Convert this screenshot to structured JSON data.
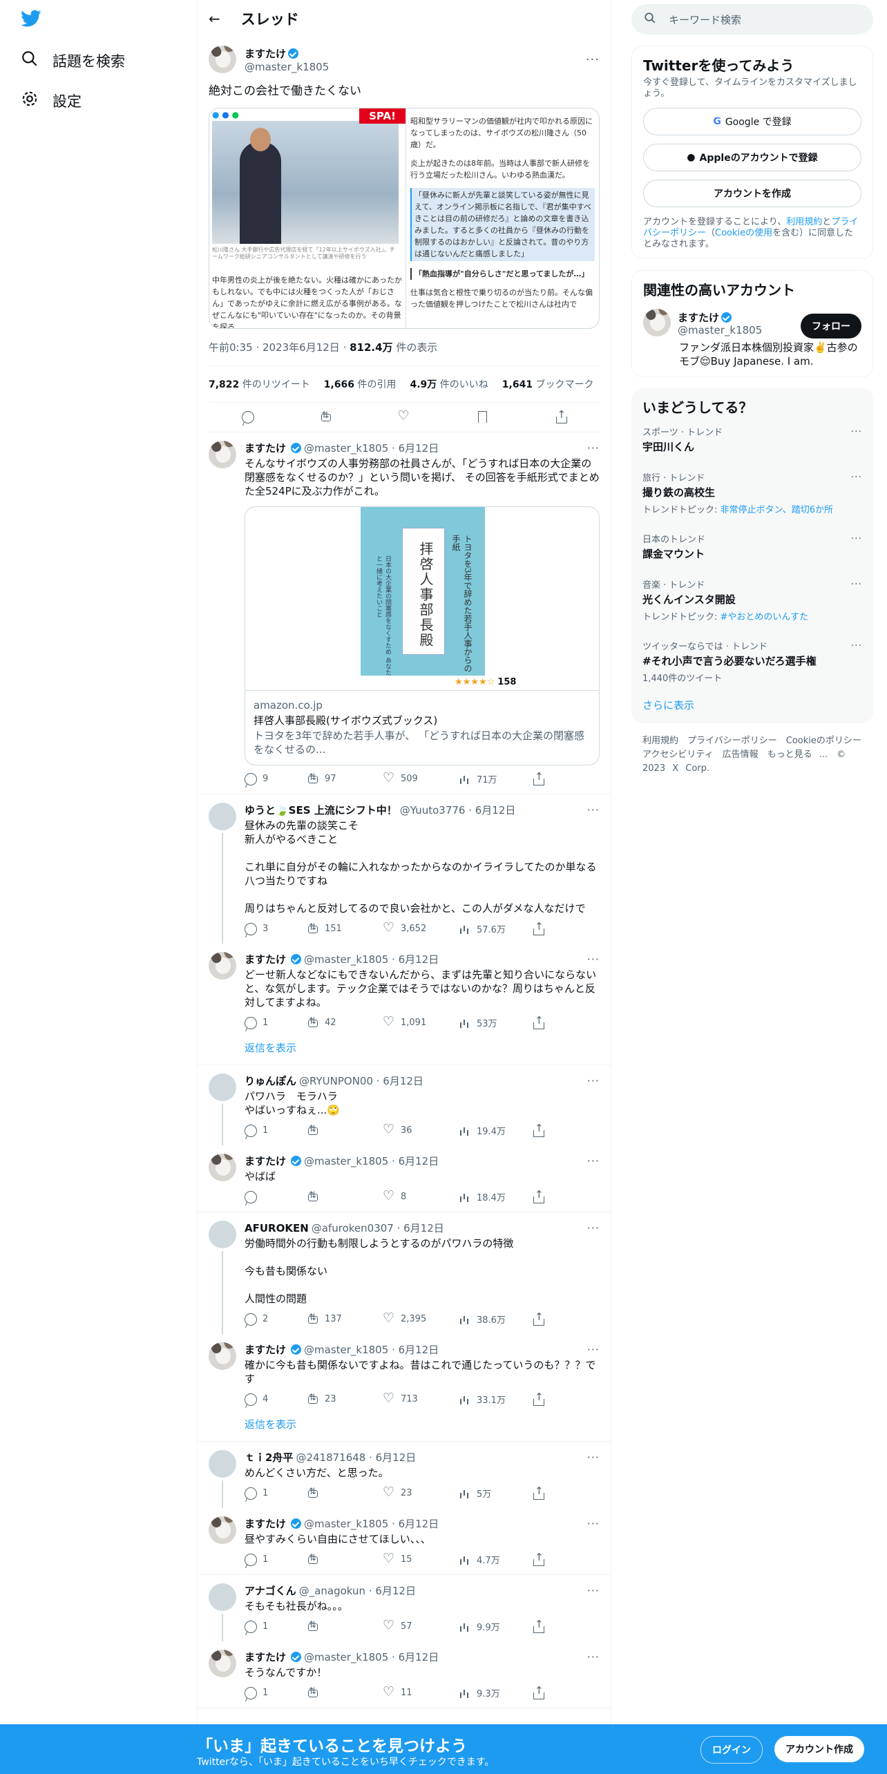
{
  "nav": {
    "items": [
      {
        "label": "話題を検索",
        "icon": "search-icon"
      },
      {
        "label": "設定",
        "icon": "gear-icon"
      }
    ]
  },
  "header": {
    "title": "スレッド"
  },
  "focal": {
    "name": "ますたけ",
    "handle": "@master_k1805",
    "text": "絶対この会社で働きたくない",
    "article": {
      "badge": "SPA!",
      "caption": "松川隆さん 大手銀行や広告代理店を経て「12年以上サイボウズ入社」。チームワーク総研シニアコンサルタントとして講演や研修を行う",
      "left_body": "中年男性の炎上が後を絶たない。火種は確かにあったかもしれない。でも中には火種をつくった人が「おじさん」であったがゆえに余計に燃え広がる事例がある。なぜこんなにも\"叩いていい存在\"になったのか。その背景を探る",
      "p1": "昭和型サラリーマンの価値観が社内で叩かれる原因になってしまったのは、サイボウズの松川隆さん（50歳）だ。",
      "p2": "炎上が起きたのは8年前。当時は人事部で新人研修を行う立場だった松川さん。いわゆる熱血漢だ。",
      "p3": "「昼休みに新人が先輩と談笑している姿が無性に見えて、オンライン掲示板に名指しで、『君が集中すべきことは目の前の研修だろ』と論めの文章を書き込みました。すると多くの社員から『昼休みの行動を制限するのはおかしい』と反論されて。昔のやり方は通じないんだと痛感しました」",
      "p4": "「熱血指導が\"自分らしさ\"だと思ってましたが…」",
      "p5": "仕事は気合と根性で乗り切るのが当たり前。そんな偏った価値観を押しつけたことで松川さんは社内で"
    },
    "time": "午前0:35 · 2023年6月12日 · ",
    "views": "812.4万",
    "views_label": " 件の表示",
    "stats": [
      {
        "n": "7,822",
        "l": " 件のリツイート"
      },
      {
        "n": "1,666",
        "l": " 件の引用"
      },
      {
        "n": "4.9万",
        "l": " 件のいいね"
      },
      {
        "n": "1,641",
        "l": " ブックマーク"
      }
    ]
  },
  "tweets": [
    {
      "name": "ますたけ",
      "verified": true,
      "handle": "@master_k1805 · 6月12日",
      "avatar": "cat",
      "text": "そんなサイボウズの人事労務部の社員さんが、「どうすれば日本の大企業の閉塞感をなくせるのか？」という問いを掲げ、 その回答を手紙形式でまとめた全524Pに及ぶ力作がこれ。",
      "card": {
        "book_title": "拝啓人事部長殿",
        "book_sub": "トヨタを3年で辞めた若手人事からの手紙",
        "book_side": "日本の大企業の閉塞感をなくすため あなたと一緒に考えたいこと",
        "rating": "158",
        "domain": "amazon.co.jp",
        "title": "拝啓人事部長殿(サイボウズ式ブックス)",
        "desc": "トヨタを3年で辞めた若手人事が、 「どうすれば日本の大企業の閉塞感をなくせるの..."
      },
      "reply": "9",
      "rt": "97",
      "like": "509",
      "views": "71万"
    },
    {
      "name": "ゆうと🍃SES 上流にシフト中！",
      "verified": false,
      "handle": "@Yuuto3776 · 6月12日",
      "avatar": "grey",
      "text": "昼休みの先輩の談笑こそ\n新人がやるべきこと\n\nこれ単に自分がその輪に入れなかったからなのかイライラしてたのか単なる八つ当たりですね\n\n周りはちゃんと反対してるので良い会社かと、この人がダメな人なだけで",
      "reply": "3",
      "rt": "151",
      "like": "3,652",
      "views": "57.6万"
    },
    {
      "name": "ますたけ",
      "verified": true,
      "handle": "@master_k1805 · 6月12日",
      "avatar": "cat",
      "text": "どーせ新人などなにもできないんだから、まずは先輩と知り合いにならないと、な気がします。テック企業ではそうではないのかな？周りはちゃんと反対してますよね。",
      "reply": "1",
      "rt": "42",
      "like": "1,091",
      "views": "53万",
      "showmore": "返信を表示"
    },
    {
      "name": "りゅんぽん",
      "verified": false,
      "handle": "@RYUNPON00 · 6月12日",
      "avatar": "grey",
      "text": "パワハラ　モラハラ\nやばいっすねぇ...🙄",
      "reply": "1",
      "rt": "",
      "like": "36",
      "views": "19.4万"
    },
    {
      "name": "ますたけ",
      "verified": true,
      "handle": "@master_k1805 · 6月12日",
      "avatar": "cat",
      "text": "やばば",
      "reply": "",
      "rt": "",
      "like": "8",
      "views": "18.4万"
    },
    {
      "name": "AFUROKEN",
      "verified": false,
      "handle": "@afuroken0307 · 6月12日",
      "avatar": "grey",
      "text": "労働時間外の行動も制限しようとするのがパワハラの特徴\n\n今も昔も関係ない\n\n人間性の問題",
      "reply": "2",
      "rt": "137",
      "like": "2,395",
      "views": "38.6万"
    },
    {
      "name": "ますたけ",
      "verified": true,
      "handle": "@master_k1805 · 6月12日",
      "avatar": "cat",
      "text": "確かに今も昔も関係ないですよね。昔はこれで通じたっていうのも？？？です",
      "reply": "4",
      "rt": "23",
      "like": "713",
      "views": "33.1万",
      "showmore": "返信を表示"
    },
    {
      "name": "ｔｉ2舟平",
      "verified": false,
      "handle": "@241871648 · 6月12日",
      "avatar": "grey",
      "text": "めんどくさい方だ、と思った。",
      "reply": "1",
      "rt": "",
      "like": "23",
      "views": "5万"
    },
    {
      "name": "ますたけ",
      "verified": true,
      "handle": "@master_k1805 · 6月12日",
      "avatar": "cat",
      "text": "昼やすみくらい自由にさせてほしい、、、",
      "reply": "1",
      "rt": "",
      "like": "15",
      "views": "4.7万"
    },
    {
      "name": "アナゴくん",
      "verified": false,
      "handle": "@_anagokun · 6月12日",
      "avatar": "grey",
      "text": "そもそも社長がね。。。",
      "reply": "1",
      "rt": "",
      "like": "57",
      "views": "9.9万"
    },
    {
      "name": "ますたけ",
      "verified": true,
      "handle": "@master_k1805 · 6月12日",
      "avatar": "cat",
      "text": "そうなんですか！",
      "reply": "1",
      "rt": "",
      "like": "11",
      "views": "9.3万"
    }
  ],
  "right": {
    "search_placeholder": "キーワード検索",
    "signup": {
      "title": "Twitterを使ってみよう",
      "sub": "今すぐ登録して、タイムラインをカスタマイズしましょう。",
      "google": "Google で登録",
      "apple": "Appleのアカウントで登録",
      "create": "アカウントを作成",
      "legal1": "アカウントを登録することにより、",
      "legal_terms": "利用規約",
      "legal2": "と",
      "legal_privacy": "プライバシーポリシー",
      "legal3": "（",
      "legal_cookie": "Cookieの使用",
      "legal4": "を含む）に同意したとみなされます。"
    },
    "related": {
      "title": "関連性の高いアカウント",
      "name": "ますたけ",
      "handle": "@master_k1805",
      "follow": "フォロー",
      "bio": "ファンダ派日本株個別投資家✌️古参のモブ😌Buy Japanese. I am."
    },
    "trends": {
      "title": "いまどうしてる？",
      "items": [
        {
          "cat": "スポーツ · トレンド",
          "name": "宇田川くん",
          "sub": ""
        },
        {
          "cat": "旅行 · トレンド",
          "name": "撮り鉄の高校生",
          "sub_pre": "トレンドトピック: ",
          "sub": "非常停止ボタン、踏切6か所"
        },
        {
          "cat": "日本のトレンド",
          "name": "課金マウント",
          "sub": ""
        },
        {
          "cat": "音楽 · トレンド",
          "name": "光くんインスタ開設",
          "sub_pre": "トレンドトピック: ",
          "sub": "#やおとめのいんすた"
        },
        {
          "cat": "ツイッターならでは · トレンド",
          "name": "#それ小声で言う必要ないだろ選手権",
          "sub_pre": "1,440件のツイート",
          "sub": ""
        }
      ],
      "more": "さらに表示"
    },
    "footer": "利用規約　プライバシーポリシー　Cookieのポリシー　アクセシビリティ　広告情報　もっと見る ...　© 2023 X Corp."
  },
  "banner": {
    "headline": "「いま」起きていることを見つけよう",
    "sub": "Twitterなら、「いま」起きていることをいち早くチェックできます。",
    "login": "ログイン",
    "register": "アカウント作成"
  },
  "colors": {
    "accent": "#1d9bf0",
    "text": "#0f1419",
    "secondary": "#536471"
  }
}
